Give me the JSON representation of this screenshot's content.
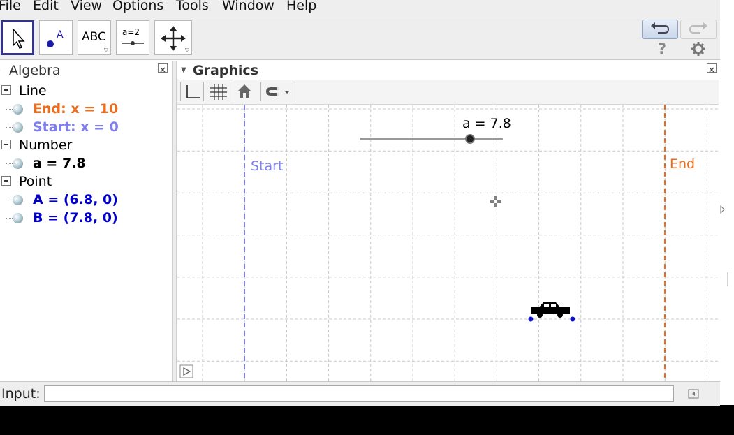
{
  "menu": [
    "File",
    "Edit",
    "View",
    "Options",
    "Tools",
    "Window",
    "Help"
  ],
  "toolbar": {
    "tools": [
      "move-tool",
      "point-tool",
      "text-tool",
      "slider-tool",
      "move-graphics-view-tool"
    ],
    "text_tool_label": "ABC",
    "slider_tool_label": "a=2",
    "help_label": "?"
  },
  "algebra": {
    "title": "Algebra",
    "groups": [
      {
        "label": "Line",
        "items": [
          {
            "text": "End: x = 10",
            "color": "#e86d1e"
          },
          {
            "text": "Start: x = 0",
            "color": "#7f7ff0"
          }
        ]
      },
      {
        "label": "Number",
        "items": [
          {
            "text": "a = 7.8",
            "color": "#000000"
          }
        ]
      },
      {
        "label": "Point",
        "items": [
          {
            "text": "A = (6.8, 0)",
            "color": "#0000c8"
          },
          {
            "text": "B = (7.8, 0)",
            "color": "#0000c8"
          }
        ]
      }
    ]
  },
  "graphics": {
    "title": "Graphics",
    "slider_label": "a = 7.8",
    "slider_value": 7.8,
    "start_label": "Start",
    "end_label": "End",
    "start_color": "#7f7ff0",
    "end_color": "#e86d1e"
  },
  "input": {
    "label": "Input:",
    "value": ""
  }
}
